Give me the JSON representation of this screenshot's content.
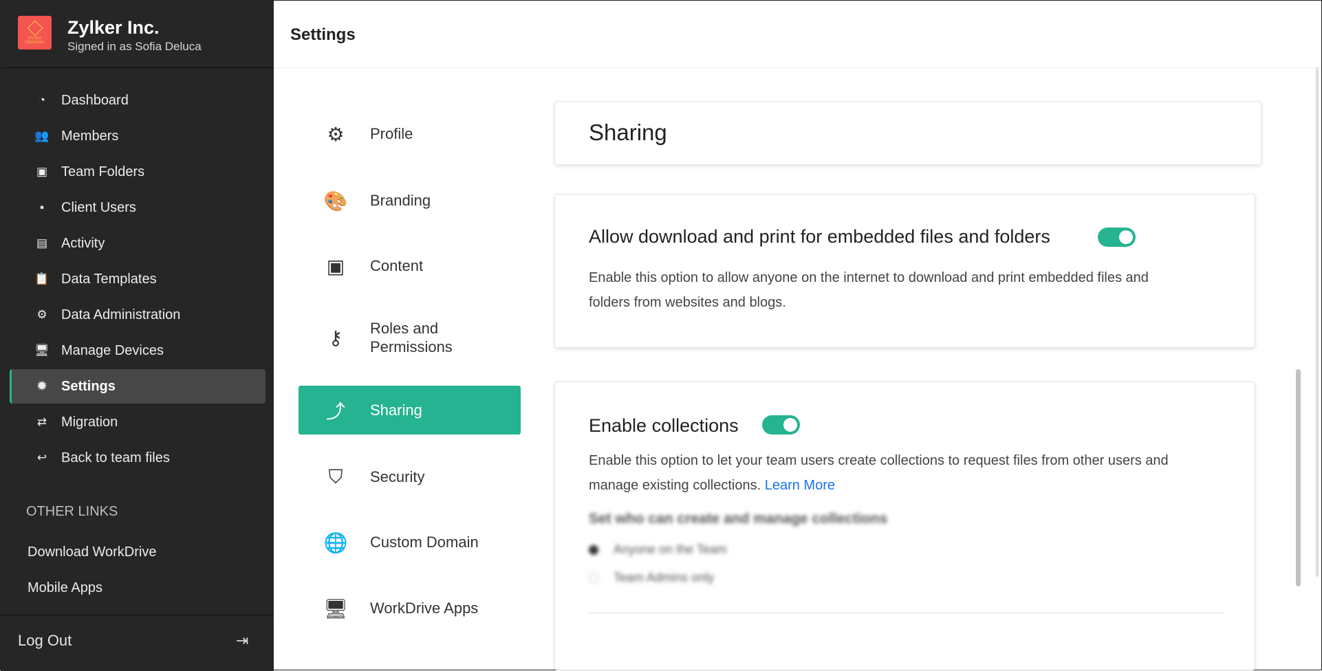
{
  "org": {
    "name": "Zylker Inc.",
    "signed_in": "Signed in as Sofia Deluca",
    "logo_text": "ZYLKER CREATIVES"
  },
  "nav": [
    {
      "label": "Dashboard",
      "icon": "gauge-icon"
    },
    {
      "label": "Members",
      "icon": "users-icon"
    },
    {
      "label": "Team Folders",
      "icon": "team-folder-icon"
    },
    {
      "label": "Client Users",
      "icon": "user-card-icon"
    },
    {
      "label": "Activity",
      "icon": "chart-icon"
    },
    {
      "label": "Data Templates",
      "icon": "clipboard-icon"
    },
    {
      "label": "Data Administration",
      "icon": "data-gear-icon"
    },
    {
      "label": "Manage Devices",
      "icon": "devices-icon"
    },
    {
      "label": "Settings",
      "icon": "gear-icon",
      "active": true
    },
    {
      "label": "Migration",
      "icon": "migration-icon"
    },
    {
      "label": "Back to team files",
      "icon": "return-icon"
    }
  ],
  "other_links": {
    "heading": "OTHER LINKS",
    "items": [
      "Download WorkDrive",
      "Mobile Apps"
    ]
  },
  "logout": "Log Out",
  "header": {
    "title": "Settings"
  },
  "settings_menu": [
    {
      "label": "Profile",
      "icon": "profile-gear-icon"
    },
    {
      "label": "Branding",
      "icon": "palette-icon"
    },
    {
      "label": "Content",
      "icon": "safe-icon"
    },
    {
      "label": "Roles and Permissions",
      "icon": "key-icon"
    },
    {
      "label": "Sharing",
      "icon": "share-icon",
      "active": true
    },
    {
      "label": "Security",
      "icon": "shield-icon"
    },
    {
      "label": "Custom Domain",
      "icon": "globe-icon"
    },
    {
      "label": "WorkDrive Apps",
      "icon": "devices-icon"
    }
  ],
  "page": {
    "title": "Sharing"
  },
  "embedded": {
    "title": "Allow download and print for embedded files and folders",
    "enabled": true,
    "desc1": "Enable this option to allow anyone on the internet to download and print embedded files and",
    "desc2": "folders from websites and blogs."
  },
  "collections": {
    "title": "Enable collections",
    "enabled": true,
    "desc1": "Enable this option to let your team users create collections to request files from other users and",
    "desc2": "manage existing collections.",
    "learn_more": "Learn More",
    "sub_heading": "Set who can create and manage collections",
    "options": [
      "Anyone on the Team",
      "Team Admins only"
    ],
    "selected": 0
  },
  "colors": {
    "accent": "#25b391",
    "sidebar": "#262626",
    "link": "#1a73e8"
  }
}
